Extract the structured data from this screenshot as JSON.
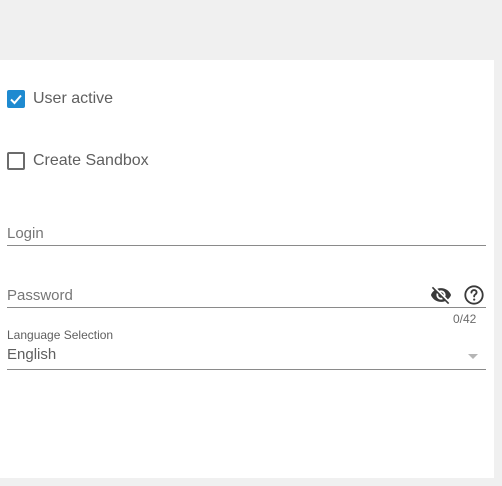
{
  "form": {
    "user_active": {
      "label": "User active",
      "checked": true
    },
    "create_sandbox": {
      "label": "Create Sandbox",
      "checked": false
    },
    "login": {
      "placeholder": "Login",
      "value": ""
    },
    "password": {
      "placeholder": "Password",
      "value": "",
      "counter": "0/42",
      "visibility_icon": "eye-off-icon",
      "help_icon": "help-circle-icon"
    },
    "language": {
      "label": "Language Selection",
      "value": "English",
      "icon": "chevron-down-icon"
    }
  },
  "colors": {
    "page_bg": "#f0f0f0",
    "card_bg": "#ffffff",
    "accent": "#1e8ad0",
    "text": "#5f5f5f",
    "underline": "#8a8a8a"
  }
}
